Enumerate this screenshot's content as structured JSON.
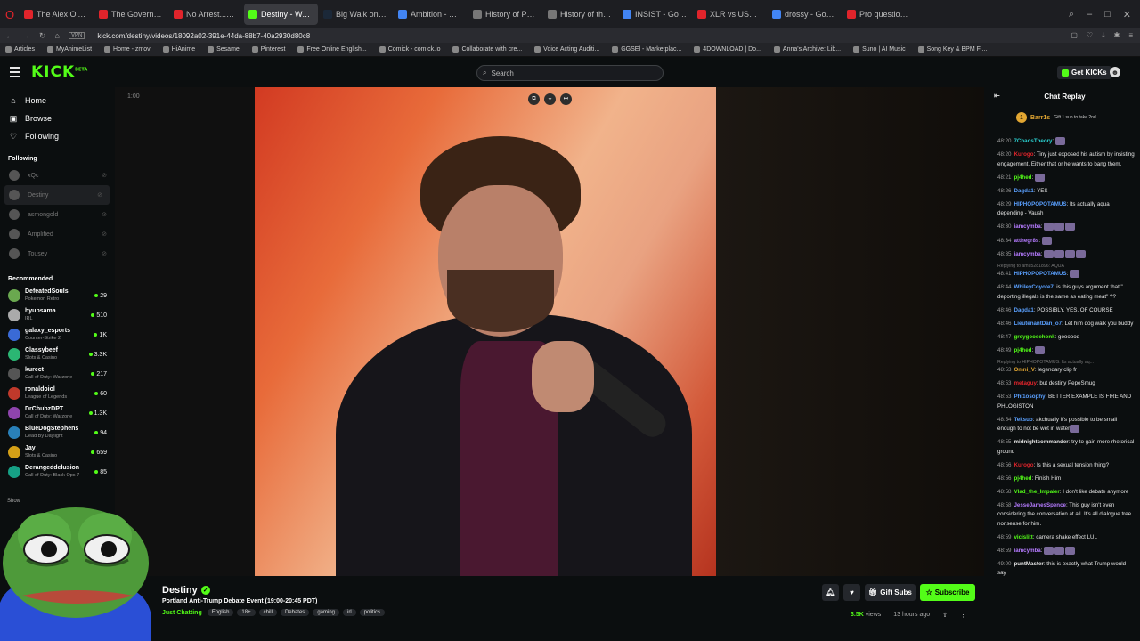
{
  "browser": {
    "tabs": [
      {
        "title": "The Alex O'Connor Podcast",
        "color": "#e0242b"
      },
      {
        "title": "The Government Shutdown",
        "color": "#e0242b"
      },
      {
        "title": "No Arrest...Has Dilvd Bee",
        "color": "#e0242b"
      },
      {
        "title": "Destiny - Watch the V",
        "color": "#53fc18",
        "active": true
      },
      {
        "title": "Big Walk on Steam",
        "color": "#1b2838"
      },
      {
        "title": "Ambition - Google Search",
        "color": "#4285f4"
      },
      {
        "title": "History of Palestine - Wik",
        "color": "#777777"
      },
      {
        "title": "History of the Israeli–Pale",
        "color": "#777777"
      },
      {
        "title": "INSIST - Google Search",
        "color": "#4285f4"
      },
      {
        "title": "XLR vs USB Mic: Which Sh",
        "color": "#e0242b"
      },
      {
        "title": "drossy - Google Search",
        "color": "#4285f4"
      },
      {
        "title": "Pro question: Are all mic",
        "color": "#e0242b"
      }
    ],
    "url": "kick.com/destiny/videos/18092a02-391e-44da-88b7-40a2930d80c8",
    "vpn": "VPN",
    "bookmarks": [
      "Articles",
      "MyAnimeList",
      "Home - zmov",
      "HiAnime",
      "Sesame",
      "Pinterest",
      "Free Online English...",
      "Comick - comick.io",
      "Collaborate with cre...",
      "Voice Acting Auditi...",
      "GGSEl - Marketplac...",
      "4DOWNLOAD | Do...",
      "Anna's Archive: Lib...",
      "Suno | AI Music",
      "Song Key & BPM Fi..."
    ]
  },
  "header": {
    "logo": "KICK",
    "logo_sup": "BETA",
    "search_placeholder": "Search",
    "get_kicks": "Get KICKs"
  },
  "sidebar": {
    "nav": [
      {
        "label": "Home",
        "icon": "home-icon",
        "glyph": "⌂"
      },
      {
        "label": "Browse",
        "icon": "browse-icon",
        "glyph": "▣"
      },
      {
        "label": "Following",
        "icon": "heart-icon",
        "glyph": "♡"
      }
    ],
    "following_title": "Following",
    "following": [
      {
        "name": "xQc"
      },
      {
        "name": "Destiny"
      },
      {
        "name": "asmongold"
      },
      {
        "name": "Amplified"
      },
      {
        "name": "Tousey"
      }
    ],
    "recommended_title": "Recommended",
    "recommended": [
      {
        "name": "DefeatedSouls",
        "cat": "Pokemon Retro",
        "viewers": "29",
        "color": "#6aa84f"
      },
      {
        "name": "hyubsama",
        "cat": "IRL",
        "viewers": "510",
        "color": "#aaaaaa"
      },
      {
        "name": "galaxy_esports",
        "cat": "Counter-Strike 2",
        "viewers": "1K",
        "color": "#3a6ad6"
      },
      {
        "name": "Classybeef",
        "cat": "Slots & Casino",
        "viewers": "3.3K",
        "color": "#2bb673"
      },
      {
        "name": "kurect",
        "cat": "Call of Duty: Warzone",
        "viewers": "217",
        "color": "#555555"
      },
      {
        "name": "ronaldoiol",
        "cat": "League of Legends",
        "viewers": "60",
        "color": "#c0392b"
      },
      {
        "name": "DrChubzDPT",
        "cat": "Call of Duty: Warzone",
        "viewers": "1.3K",
        "color": "#8e44ad"
      },
      {
        "name": "BlueDogStephens",
        "cat": "Dead By Daylight",
        "viewers": "94",
        "color": "#2980b9"
      },
      {
        "name": "Jay",
        "cat": "Slots & Casino",
        "viewers": "659",
        "color": "#d4a017"
      },
      {
        "name": "Derangeddelusion",
        "cat": "Call of Duty: Black Ops 7",
        "viewers": "85",
        "color": "#16a085"
      }
    ],
    "show_more": "Show"
  },
  "video": {
    "time": "1:00"
  },
  "info": {
    "channel": "Destiny",
    "title": "Portland Anti-Trump Debate Event (19:00-20:45 PDT)",
    "category": "Just Chatting",
    "tags": [
      "English",
      "18+",
      "chill",
      "Debates",
      "gaming",
      "irl",
      "politics"
    ],
    "gift_subs": "Gift Subs",
    "subscribe": "Subscribe",
    "views": "3.5K",
    "views_label": "views",
    "ago": "13 hours ago"
  },
  "chat": {
    "title": "Chat Replay",
    "pinned_user": "Barr1s",
    "pinned_count": "1",
    "pinned_text": "Gift 1 sub to take 2nd",
    "messages": [
      {
        "t": "48:20",
        "u": "7ChaosTheory",
        "c": "#2bd3d3",
        "m": "",
        "e": 1
      },
      {
        "t": "48:20",
        "u": "Kurogo",
        "c": "#e0242b",
        "m": "Tiny just exposed his autism by insisting engagement. Either that or he wants to bang them."
      },
      {
        "t": "48:21",
        "u": "pj4hed",
        "c": "#53fc18",
        "m": "",
        "e": 1
      },
      {
        "t": "48:26",
        "u": "Dagda1",
        "c": "#5aa0ff",
        "m": "YES"
      },
      {
        "t": "48:29",
        "u": "HIPHOPOPOTAMUS",
        "c": "#5aa0ff",
        "m": "Its actually aqua depending - Vaush"
      },
      {
        "t": "48:30",
        "u": "iamcymba",
        "c": "#b57bff",
        "m": "",
        "e": 3
      },
      {
        "t": "48:34",
        "u": "atthegr8s",
        "c": "#b57bff",
        "m": "",
        "e": 1
      },
      {
        "t": "48:35",
        "u": "iamcymba",
        "c": "#b57bff",
        "m": "",
        "e": 4
      },
      {
        "t": "48:41",
        "u": "HIPHOPOPOTAMUS",
        "c": "#5aa0ff",
        "m": "",
        "e": 1,
        "reply": "Replying to amu5281896: AQUA"
      },
      {
        "t": "48:44",
        "u": "WhileyCoyote7",
        "c": "#5aa0ff",
        "m": "is this guys argument that \" deporting illegals is the same as eating meat\" ??"
      },
      {
        "t": "48:46",
        "u": "Dagda1",
        "c": "#5aa0ff",
        "m": "POSSIBLY, YES, OF COURSE"
      },
      {
        "t": "48:46",
        "u": "LieutenantDan_o7",
        "c": "#5aa0ff",
        "m": "Let him dog walk you buddy"
      },
      {
        "t": "48:47",
        "u": "greygoosehonk",
        "c": "#53fc18",
        "m": "goooood"
      },
      {
        "t": "48:49",
        "u": "pj4hed",
        "c": "#53fc18",
        "m": "",
        "e": 1
      },
      {
        "t": "48:53",
        "u": "Omni_V",
        "c": "#e2a632",
        "m": "legendary clip fr",
        "reply": "Replying to HIPHOPOTAMUS: Its actually aq..."
      },
      {
        "t": "48:53",
        "u": "metaguy",
        "c": "#e0242b",
        "m": "but destiny PepeSmug"
      },
      {
        "t": "48:53",
        "u": "Phi1osophy",
        "c": "#5aa0ff",
        "m": "BETTER EXAMPLE IS FIRE AND PHLOGISTON"
      },
      {
        "t": "48:54",
        "u": "Teksuo",
        "c": "#5aa0ff",
        "m": "akchually it's possible to be small enough to not be wet in water",
        "e": 1
      },
      {
        "t": "48:55",
        "u": "midnightcommander",
        "c": "#e6e6e6",
        "m": "try to gain more rhetorical ground"
      },
      {
        "t": "48:56",
        "u": "Kurogo",
        "c": "#e0242b",
        "m": "Is this a sexual tension thing?"
      },
      {
        "t": "48:56",
        "u": "pj4hed",
        "c": "#53fc18",
        "m": "Finish Him"
      },
      {
        "t": "48:58",
        "u": "Vlad_the_Impaler",
        "c": "#53fc18",
        "m": "I don't like debate anymore"
      },
      {
        "t": "48:58",
        "u": "JesseJamesSpence",
        "c": "#b57bff",
        "m": "This guy isn't even considering the conversation at all. It's all dialogue tree nonsense for him."
      },
      {
        "t": "48:59",
        "u": "vicislitt",
        "c": "#53fc18",
        "m": "camera shake effect LUL"
      },
      {
        "t": "48:59",
        "u": "iamcymba",
        "c": "#b57bff",
        "m": "",
        "e": 3
      },
      {
        "t": "49:00",
        "u": "puntMaster",
        "c": "#e6e6e6",
        "m": "this is exactly what Trump would say"
      }
    ]
  }
}
